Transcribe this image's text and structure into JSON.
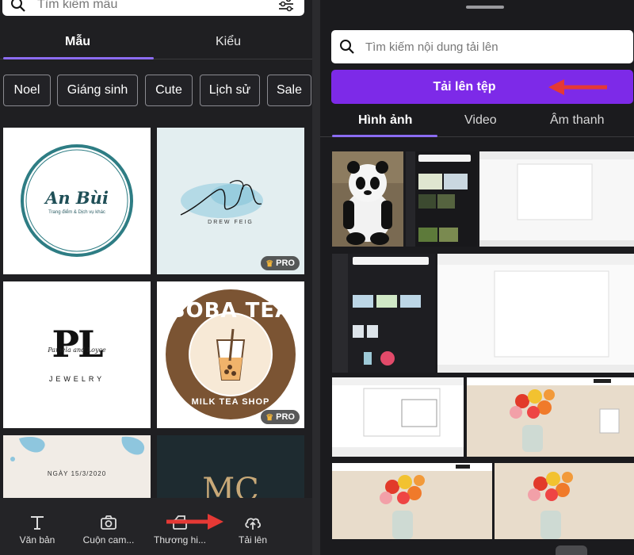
{
  "left": {
    "search": {
      "placeholder": "Tìm kiếm mẫu"
    },
    "tabs": [
      {
        "label": "Mẫu"
      },
      {
        "label": "Kiểu"
      }
    ],
    "chips": [
      {
        "label": "Noel"
      },
      {
        "label": "Giáng sinh"
      },
      {
        "label": "Cute"
      },
      {
        "label": "Lịch sử"
      },
      {
        "label": "Sale"
      }
    ],
    "templates": [
      {
        "name": "An Bùi",
        "subtitle": "Trang điểm & Dịch vụ khác",
        "pro": false
      },
      {
        "name": "DF",
        "subtitle": "DREW FEIG",
        "pro": true,
        "pro_label": "PRO"
      },
      {
        "name": "PL",
        "subtitle": "JEWELRY",
        "script": "Pamela and Loyce",
        "pro": false
      },
      {
        "name": "BOBA TEA",
        "subtitle": "MILK TEA SHOP",
        "pro": true,
        "pro_label": "PRO"
      },
      {
        "date": "NGÀY 15/3/2020",
        "pro": false
      },
      {
        "name": "MC",
        "pro": false
      }
    ],
    "nav": [
      {
        "label": "Văn bản",
        "icon": "text-icon"
      },
      {
        "label": "Cuộn cam...",
        "icon": "camera-icon"
      },
      {
        "label": "Thương hi...",
        "icon": "brand-icon"
      },
      {
        "label": "Tải lên",
        "icon": "upload-cloud-icon"
      }
    ]
  },
  "right": {
    "search": {
      "placeholder": "Tìm kiếm nội dung tải lên"
    },
    "upload_button": "Tải lên tệp",
    "tabs": [
      {
        "label": "Hình ảnh"
      },
      {
        "label": "Video"
      },
      {
        "label": "Âm thanh"
      }
    ]
  },
  "colors": {
    "accent": "#7d2ae8",
    "tab_underline": "#8b6cf2",
    "annotation_arrow": "#e53935",
    "boba_brown": "#7b5433",
    "logo_teal": "#2e7d84"
  }
}
